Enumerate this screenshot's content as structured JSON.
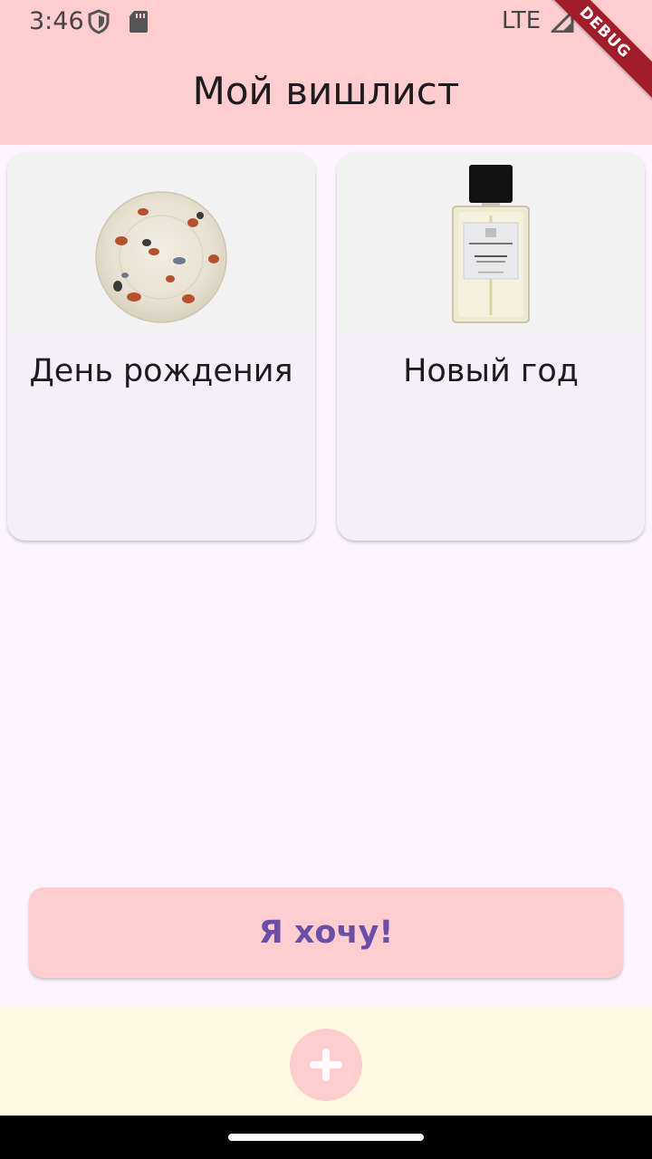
{
  "status_bar": {
    "time": "3:46",
    "network": "LTE",
    "icons": [
      "shield-icon",
      "sd-card-icon",
      "signal-icon",
      "battery-icon"
    ]
  },
  "debug_banner": "DEBUG",
  "app_bar": {
    "title": "Мой вишлист"
  },
  "wishlists": [
    {
      "title": "День рождения",
      "image": "plate-image"
    },
    {
      "title": "Новый год",
      "image": "perfume-image"
    }
  ],
  "want_button": {
    "label": "Я хочу!"
  },
  "bottom_bar": {
    "fab_icon": "plus-icon"
  },
  "colors": {
    "app_bar": "#ffcccf",
    "background": "#fcf5fd",
    "card": "#f3f0f7",
    "button_text": "#6a4fa6",
    "bottom_bar": "#fff8e3"
  }
}
